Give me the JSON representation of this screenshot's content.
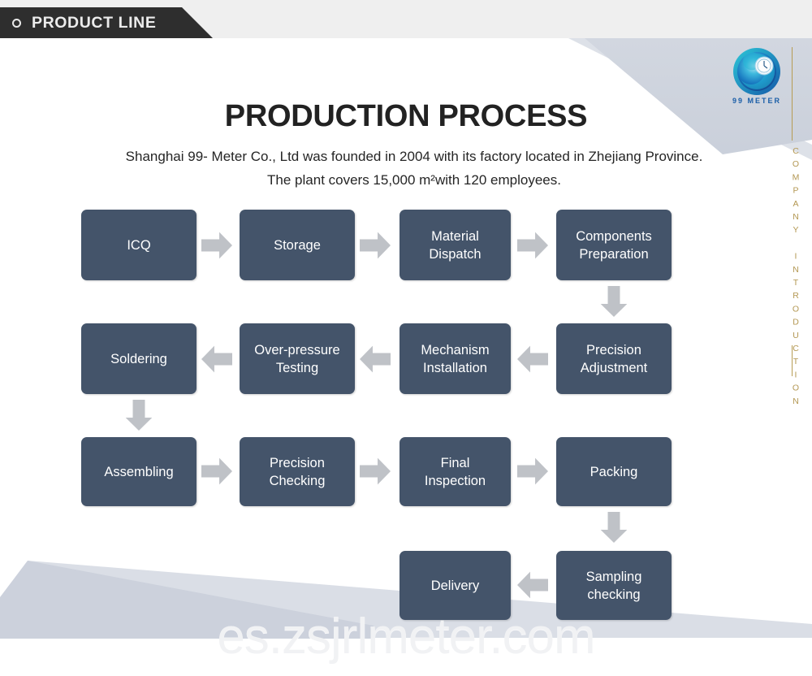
{
  "header": {
    "banner_label": "PRODUCT LINE",
    "banner_icon": "circle-outline-icon",
    "banner_color": "#2e2e2e",
    "strip_color": "#efefef"
  },
  "brand": {
    "logo_name": "99-meter-logo",
    "logo_text": "99 METER",
    "logo_color": "#1a8fc8",
    "side_label": "COMPANY INTRODUCTION",
    "side_label_color": "#b39752"
  },
  "title": "PRODUCTION PROCESS",
  "subtitle": "Shanghai 99- Meter Co., Ltd was founded in 2004 with its factory located in Zhejiang Province. The plant covers 15,000 m²with 120 employees.",
  "theme": {
    "box_color": "#44546a",
    "arrow_color": "#bfc2c7",
    "wedge_color": "#ced3dd",
    "title_color": "#222222"
  },
  "flow": {
    "rows": [
      {
        "direction": "left-to-right",
        "steps": [
          "ICQ",
          "Storage",
          "Material Dispatch",
          "Components Preparation"
        ]
      },
      {
        "direction": "right-to-left",
        "steps": [
          "Precision Adjustment",
          "Mechanism Installation",
          "Over-pressure Testing",
          "Soldering"
        ]
      },
      {
        "direction": "left-to-right",
        "steps": [
          "Assembling",
          "Precision Checking",
          "Final Inspection",
          "Packing"
        ]
      },
      {
        "direction": "right-to-left",
        "steps": [
          "Sampling checking",
          "Delivery"
        ]
      }
    ],
    "boxes": {
      "icq": "ICQ",
      "storage": "Storage",
      "material_dispatch_line1": "Material",
      "material_dispatch_line2": "Dispatch",
      "components_preparation_line1": "Components",
      "components_preparation_line2": "Preparation",
      "precision_adjustment_line1": "Precision",
      "precision_adjustment_line2": "Adjustment",
      "mechanism_installation_line1": "Mechanism",
      "mechanism_installation_line2": "Installation",
      "over_pressure_testing_line1": "Over-pressure",
      "over_pressure_testing_line2": "Testing",
      "soldering": "Soldering",
      "assembling": "Assembling",
      "precision_checking_line1": "Precision",
      "precision_checking_line2": "Checking",
      "final_inspection_line1": "Final",
      "final_inspection_line2": "Inspection",
      "packing": "Packing",
      "sampling_checking_line1": "Sampling",
      "sampling_checking_line2": "checking",
      "delivery": "Delivery"
    }
  },
  "watermark": "es.zsjrlmeter.com"
}
